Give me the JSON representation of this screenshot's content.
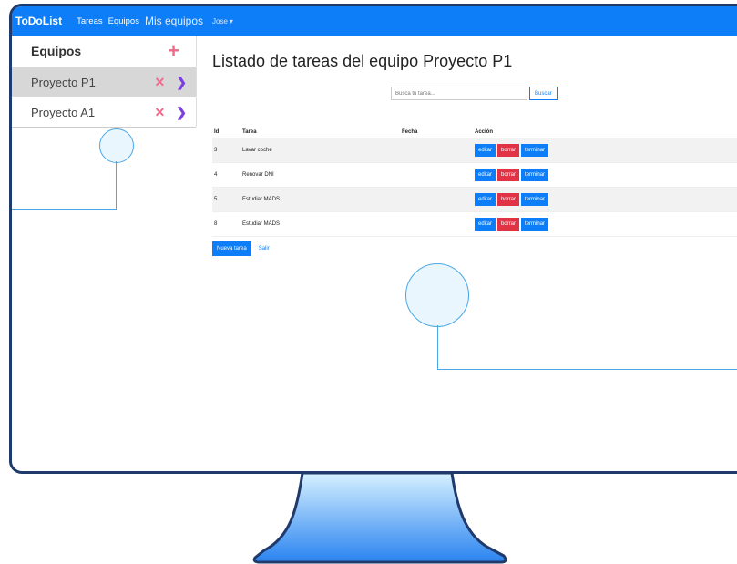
{
  "navbar": {
    "brand": "ToDoList",
    "links": [
      "Tareas",
      "Equipos",
      "Mis equipos"
    ],
    "user": "Jose"
  },
  "sidebar": {
    "title": "Equipos",
    "add_icon": "plus-icon",
    "items": [
      {
        "label": "Proyecto P1",
        "active": true
      },
      {
        "label": "Proyecto A1",
        "active": false
      }
    ]
  },
  "main": {
    "title": "Listado de tareas del equipo Proyecto P1",
    "search": {
      "placeholder": "Busca tu tarea...",
      "button": "Buscar"
    },
    "table": {
      "headers": [
        "Id",
        "Tarea",
        "Fecha",
        "Acción"
      ],
      "rows": [
        {
          "id": "3",
          "tarea": "Lavar coche",
          "fecha": ""
        },
        {
          "id": "4",
          "tarea": "Renovar DNI",
          "fecha": ""
        },
        {
          "id": "5",
          "tarea": "Estudiar MADS",
          "fecha": ""
        },
        {
          "id": "8",
          "tarea": "Estudiar MADS",
          "fecha": ""
        }
      ],
      "actions": {
        "edit": "editar",
        "delete": "borrar",
        "finish": "terminar"
      }
    },
    "new_task": "Nueva tarea",
    "exit": "Salir"
  },
  "colors": {
    "primary": "#0d7ef7",
    "danger": "#e03345",
    "delete_icon": "#f06a8a",
    "chevron": "#7a3fe0",
    "monitor_frame": "#1f3a6b",
    "stand_gradient_top": "#cfeeff",
    "stand_gradient_bottom": "#1f7ff0"
  }
}
